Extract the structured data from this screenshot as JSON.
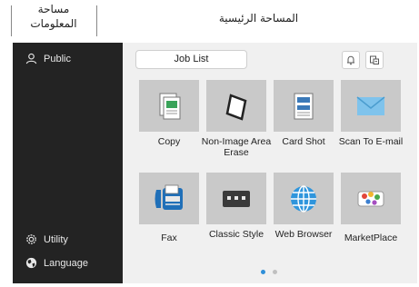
{
  "header": {
    "info_line1": "مساحة",
    "info_line2": "المعلومات",
    "main_title": "المساحة الرئيسية"
  },
  "sidebar": {
    "user": {
      "label": "Public",
      "icon": "user-icon"
    },
    "utility": {
      "label": "Utility",
      "icon": "gear-icon"
    },
    "language": {
      "label": "Language",
      "icon": "globe-icon"
    }
  },
  "toolbar": {
    "job_list": "Job List",
    "icons": [
      "bell-icon",
      "device-status-icon"
    ]
  },
  "tiles": [
    {
      "label": "Copy",
      "icon": "copy-icon"
    },
    {
      "label": "Non-Image Area Erase",
      "icon": "non-image-erase-icon"
    },
    {
      "label": "Card Shot",
      "icon": "card-shot-icon"
    },
    {
      "label": "Scan To E-mail",
      "icon": "scan-email-icon"
    },
    {
      "label": "Fax",
      "icon": "fax-icon"
    },
    {
      "label": "Classic Style",
      "icon": "classic-style-icon"
    },
    {
      "label": "Web Browser",
      "icon": "web-browser-icon"
    },
    {
      "label": "MarketPlace",
      "icon": "marketplace-icon"
    }
  ],
  "pagination": {
    "pages": 2,
    "current": 1
  },
  "colors": {
    "accent": "#2f8fd8",
    "sidebar_bg": "#232323",
    "tile_bg": "#c9c9c9",
    "screen_bg": "#f0f0f0"
  }
}
